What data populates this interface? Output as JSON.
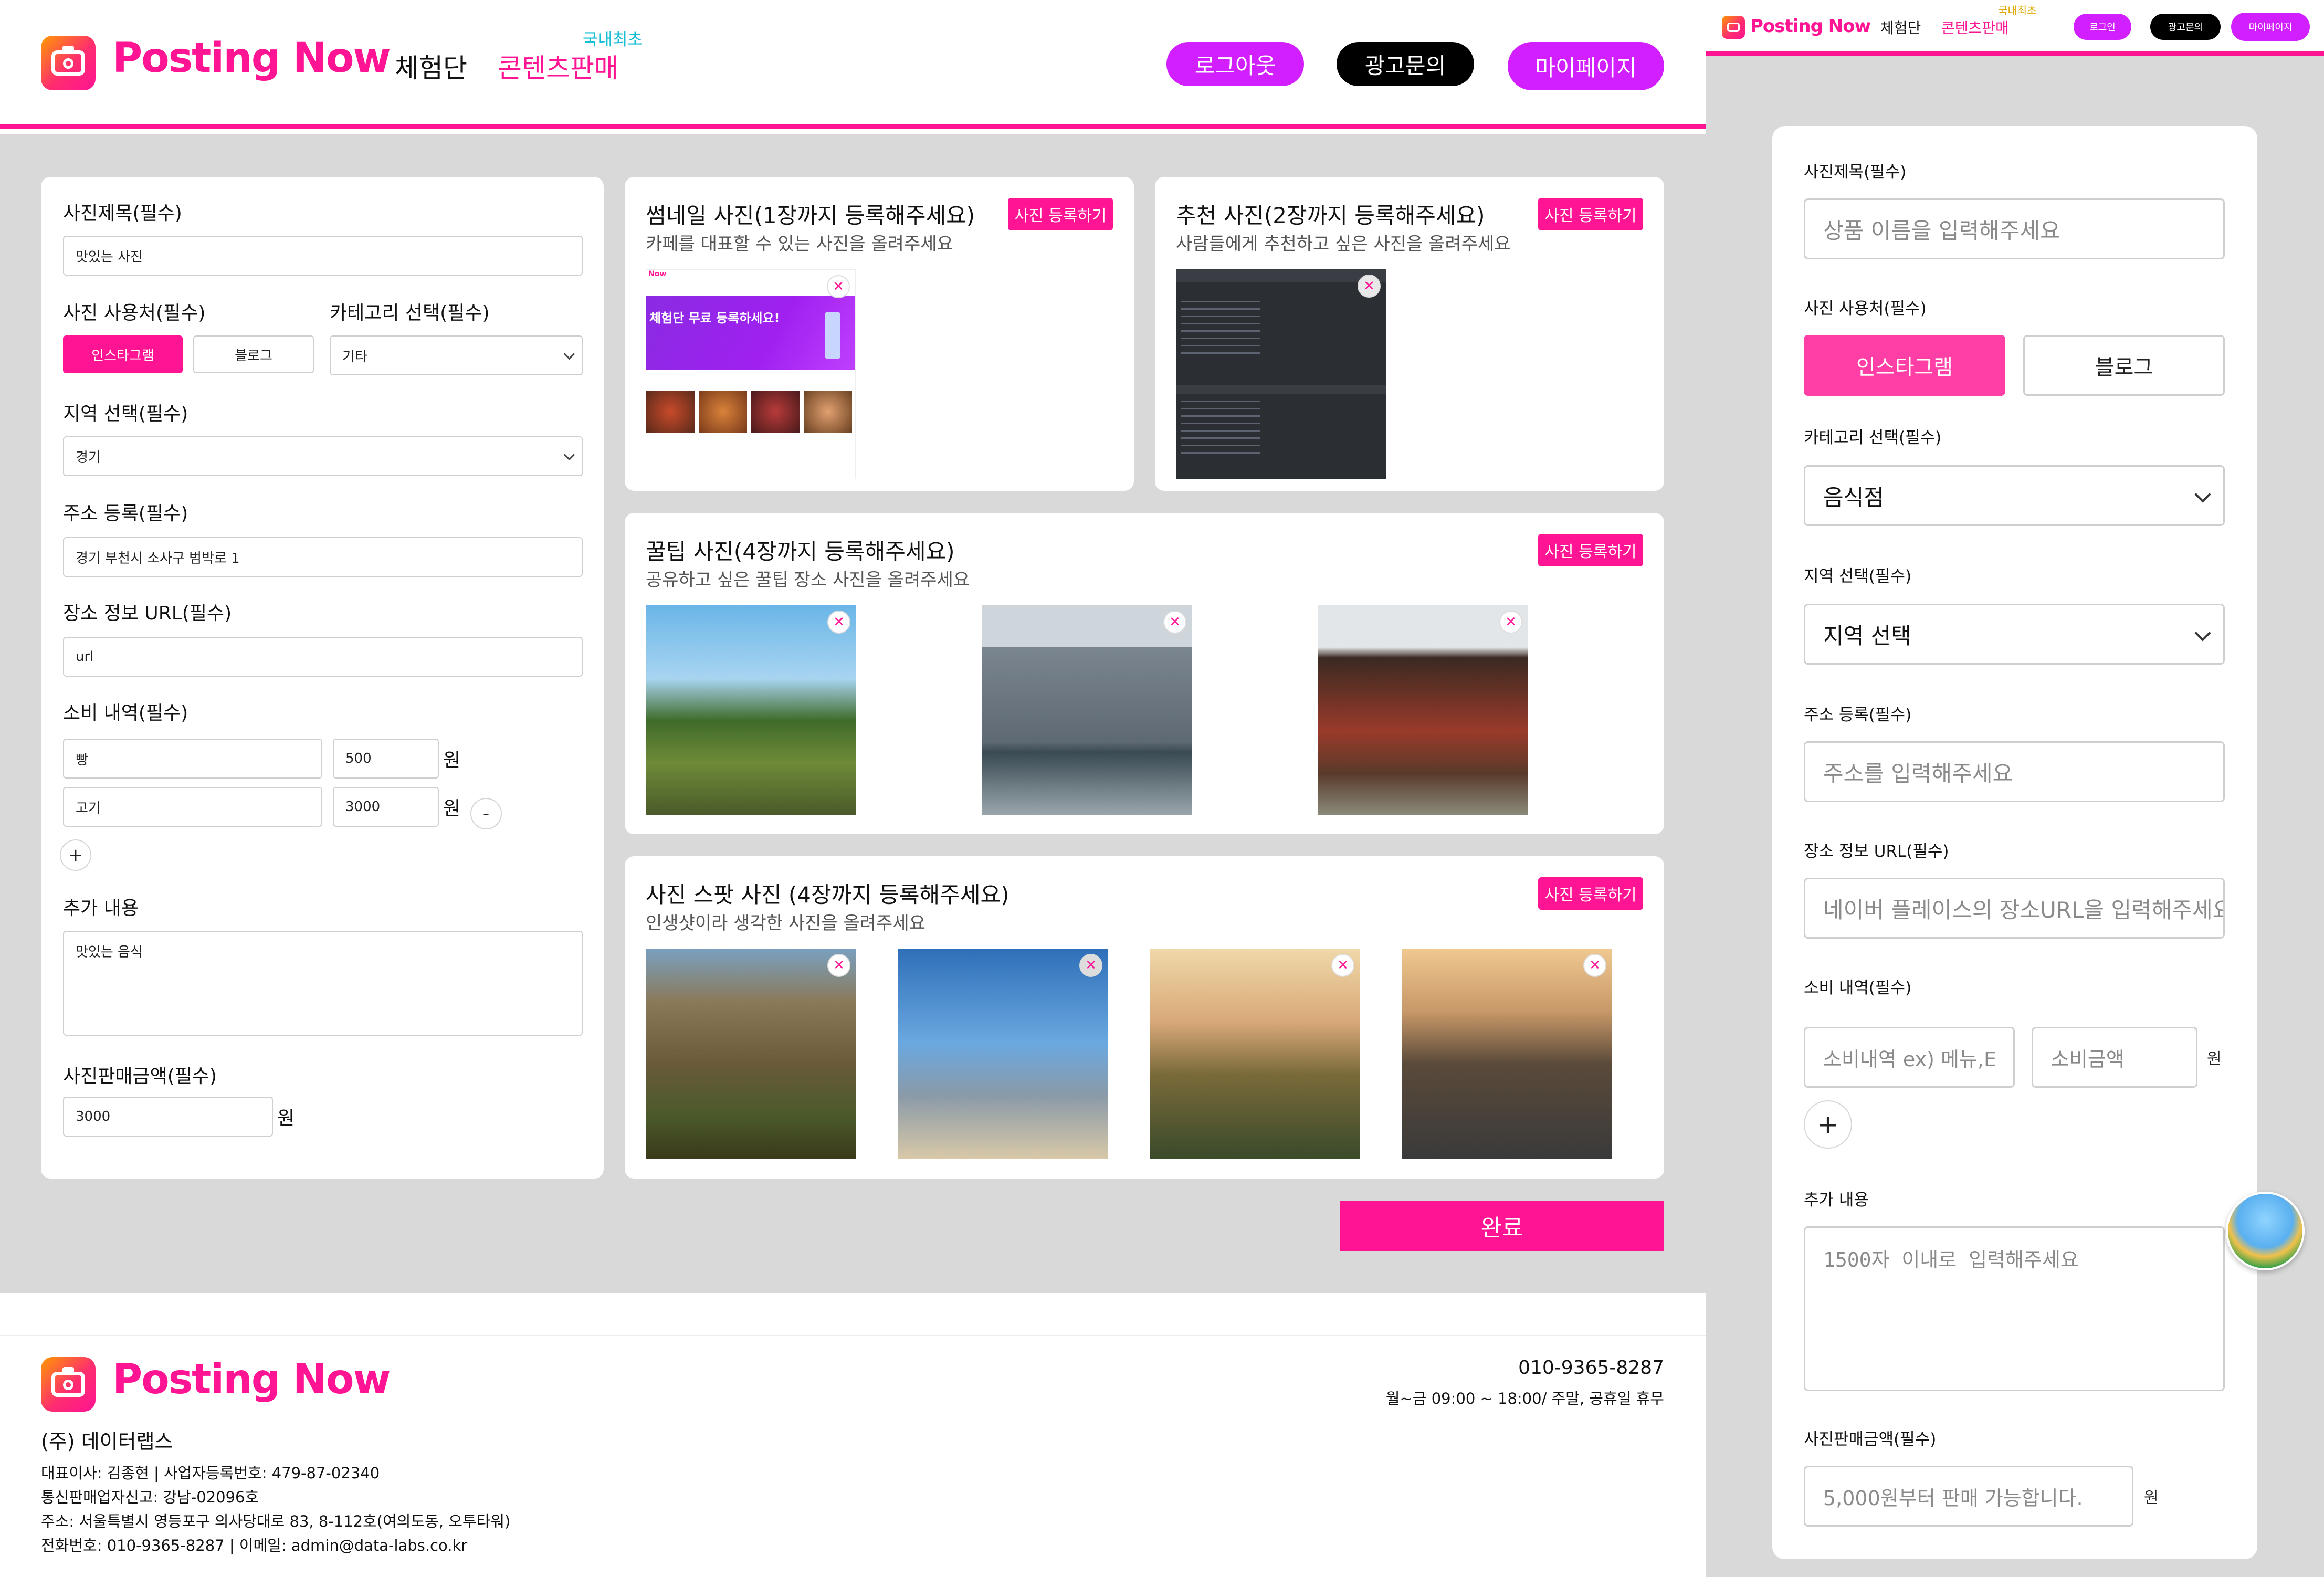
{
  "brand": "Posting Now",
  "header": {
    "nav_trial": "체험단",
    "nav_content": "콘텐츠판매",
    "nav_badge": "국내최초",
    "logout": "로그아웃",
    "ad_inquiry": "광고문의",
    "mypage": "마이페이지"
  },
  "colors": {
    "accent": "#ff1493",
    "purple": "#d21fff",
    "black": "#000000"
  },
  "icons": {
    "logo": "camera-icon",
    "remove": "close-icon",
    "add": "plus-icon",
    "remove_row": "minus-icon",
    "select": "chevron-down-icon",
    "floating": "beach-icon"
  },
  "form": {
    "photo_title_label": "사진제목(필수)",
    "photo_title_value": "맛있는 사진",
    "usage_label": "사진 사용처(필수)",
    "usage_instagram": "인스타그램",
    "usage_blog": "블로그",
    "category_label": "카테고리 선택(필수)",
    "category_value": "기타",
    "region_label": "지역 선택(필수)",
    "region_value": "경기",
    "address_label": "주소 등록(필수)",
    "address_value": "경기 부천시 소사구 범박로 1",
    "url_label": "장소 정보 URL(필수)",
    "url_value": "url",
    "spend_label": "소비 내역(필수)",
    "spend_rows": [
      {
        "item": "빵",
        "amount": "500"
      },
      {
        "item": "고기",
        "amount": "3000"
      }
    ],
    "won": "원",
    "minus": "-",
    "plus": "+",
    "extra_label": "추가 내용",
    "extra_value": "맛있는  음식",
    "price_label": "사진판매금액(필수)",
    "price_value": "3000"
  },
  "sections": {
    "thumbnail": {
      "title": "썸네일 사진(1장까지 등록해주세요)",
      "sub": "카페를 대표할 수 있는 사진을 올려주세요",
      "button": "사진 등록하기"
    },
    "recommend": {
      "title": "추천 사진(2장까지 등록해주세요)",
      "sub": "사람들에게 추천하고 싶은 사진을 올려주세요",
      "button": "사진 등록하기"
    },
    "tips": {
      "title": "꿀팁 사진(4장까지 등록해주세요)",
      "sub": "공유하고 싶은 꿀팁 장소 사진을 올려주세요",
      "button": "사진 등록하기"
    },
    "spots": {
      "title": "사진 스팟 사진 (4장까지 등록해주세요)",
      "sub": "인생샷이라 생각한 사진을 올려주세요",
      "button": "사진 등록하기"
    }
  },
  "thumb_preview": {
    "brand": "Now",
    "banner": "체험단 무료 등록하세요!"
  },
  "submit": "완료",
  "footer": {
    "company": "(주) 데이터랩스",
    "line1": "대표이사: 김종현 | 사업자등록번호: 479-87-02340",
    "line2": "통신판매업자신고: 강남-02096호",
    "line3": "주소: 서울특별시 영등포구 의사당대로 83, 8-112호(여의도동, 오투타워)",
    "line4": "전화번호: 010-9365-8287 | 이메일: admin@data-labs.co.kr",
    "phone": "010-9365-8287",
    "hours": "월~금 09:00 ~ 18:00/ 주말, 공휴일 휴무"
  },
  "mobile": {
    "logout": "로그인",
    "ad_inquiry": "광고문의",
    "mypage": "마이페이지",
    "title_label": "사진제목(필수)",
    "title_placeholder": "상품 이름을 입력해주세요",
    "usage_label": "사진 사용처(필수)",
    "usage_instagram": "인스타그램",
    "usage_blog": "블로그",
    "category_label": "카테고리 선택(필수)",
    "category_value": "음식점",
    "region_label": "지역 선택(필수)",
    "region_value": "지역 선택",
    "address_label": "주소 등록(필수)",
    "address_placeholder": "주소를 입력해주세요",
    "url_label": "장소 정보 URL(필수)",
    "url_placeholder": "네이버 플레이스의 장소URL을 입력해주세요",
    "spend_label": "소비 내역(필수)",
    "spend_item_placeholder": "소비내역 ex) 메뉴,E",
    "spend_amount_placeholder": "소비금액",
    "won": "원",
    "extra_label": "추가 내용",
    "extra_placeholder": "1500자  이내로  입력해주세요",
    "price_label": "사진판매금액(필수)",
    "price_placeholder": "5,000원부터 판매 가능합니다."
  }
}
